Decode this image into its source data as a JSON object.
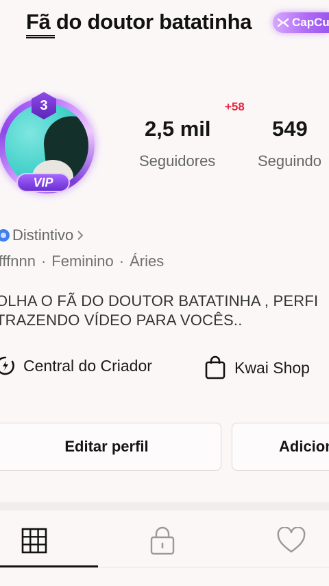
{
  "header": {
    "title": "Fã do doutor batatinha",
    "badge_label": "CapCut",
    "badge_icon": "capcut-icon"
  },
  "profile": {
    "level": "3",
    "vip_label": "VIP",
    "followers_delta": "+58",
    "followers_count": "2,5 mil",
    "followers_label": "Seguidores",
    "following_count": "549",
    "following_label": "Seguindo",
    "badge_link": "Distintivo",
    "meta": [
      "ffffnnn",
      "Feminino",
      "Áries"
    ],
    "bio": "OLHA O FÃ DO DOUTOR BATATINHA , PERFI\nTRAZENDO VÍDEO PARA VOCÊS.."
  },
  "links": {
    "creator_center": "Central do Criador",
    "shop": "Kwai Shop"
  },
  "buttons": {
    "edit_profile": "Editar perfil",
    "add_friends": "Adicion"
  },
  "tabs": [
    {
      "name": "grid",
      "icon": "grid-icon",
      "active": true
    },
    {
      "name": "private",
      "icon": "lock-icon",
      "active": false
    },
    {
      "name": "liked",
      "icon": "heart-icon",
      "active": false
    }
  ],
  "colors": {
    "accent_purple": "#9b57f0",
    "delta_red": "#e8233a",
    "badge_blue": "#3f7ff0",
    "background": "#fbf7f7"
  }
}
